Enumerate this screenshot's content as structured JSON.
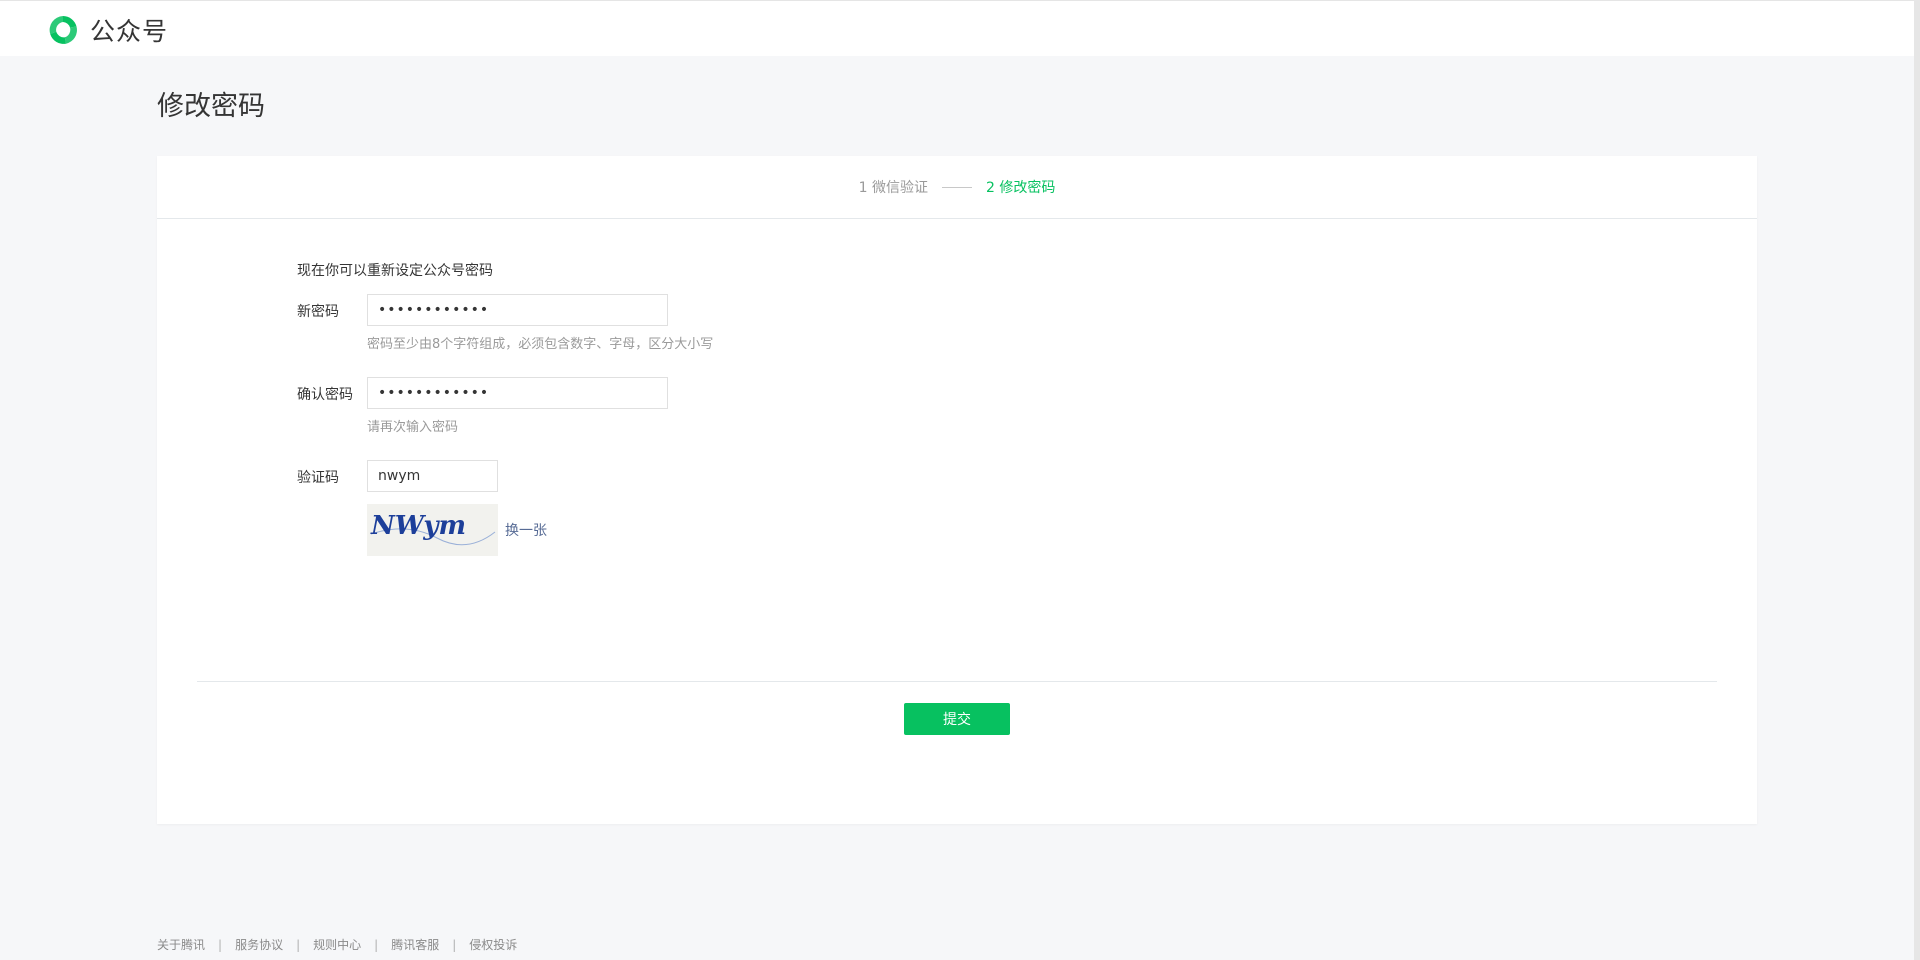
{
  "header": {
    "logo_text": "公众号",
    "brand_color": "#07c160"
  },
  "page": {
    "title": "修改密码"
  },
  "steps": [
    {
      "label": "1 微信验证",
      "active": false
    },
    {
      "label": "2 修改密码",
      "active": true
    }
  ],
  "form": {
    "intro": "现在你可以重新设定公众号密码",
    "new_password": {
      "label": "新密码",
      "value": "••••••••••••",
      "hint": "密码至少由8个字符组成，必须包含数字、字母，区分大小写"
    },
    "confirm_password": {
      "label": "确认密码",
      "value": "••••••••••••",
      "hint": "请再次输入密码"
    },
    "captcha": {
      "label": "验证码",
      "value": "nwym",
      "image_text": "NWym",
      "refresh_label": "换一张"
    },
    "submit_label": "提交"
  },
  "footer": {
    "links": [
      "关于腾讯",
      "服务协议",
      "规则中心",
      "腾讯客服",
      "侵权投诉"
    ]
  },
  "colors": {
    "accent": "#07c160",
    "link": "#576b95",
    "hint": "#9a9a9a"
  }
}
